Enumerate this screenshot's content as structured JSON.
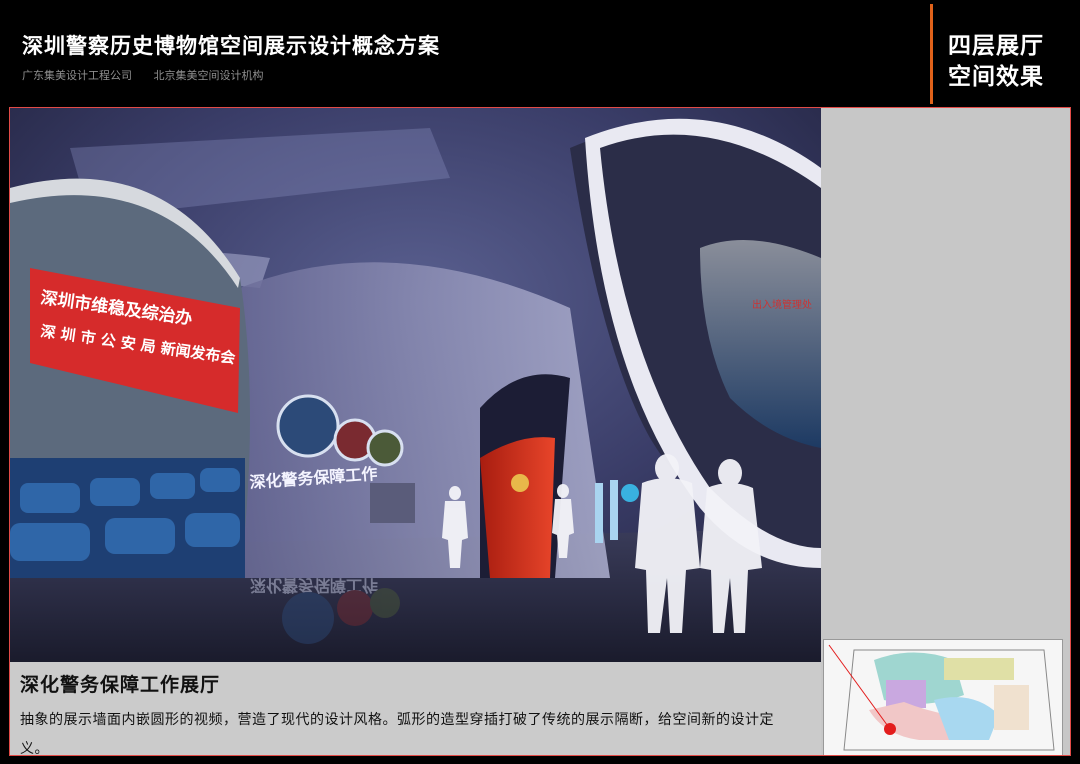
{
  "header": {
    "title": "深圳警察历史博物馆空间展示设计概念方案",
    "orgs": [
      "广东集美设计工程公司",
      "北京集美空间设计机构"
    ],
    "section_label_line1": "四层展厅",
    "section_label_line2": "空间效果"
  },
  "render": {
    "banner_line1": "深圳市维稳及综治办",
    "banner_line2": "深 圳 市 公 安 局 新闻发布会",
    "wall_text": "深化警务保障工作",
    "reflection_text": "深化警务保障工作",
    "right_sign_text": "出入境管理处"
  },
  "caption": {
    "title": "深化警务保障工作展厅",
    "description": "抽象的展示墙面内嵌圆形的视频，营造了现代的设计风格。弧形的造型穿插打破了传统的展示隔断，给空间新的设计定义。"
  },
  "colors": {
    "accent_orange": "#e0621a",
    "frame_red": "#e34b47",
    "banner_red": "#d62b2b"
  }
}
